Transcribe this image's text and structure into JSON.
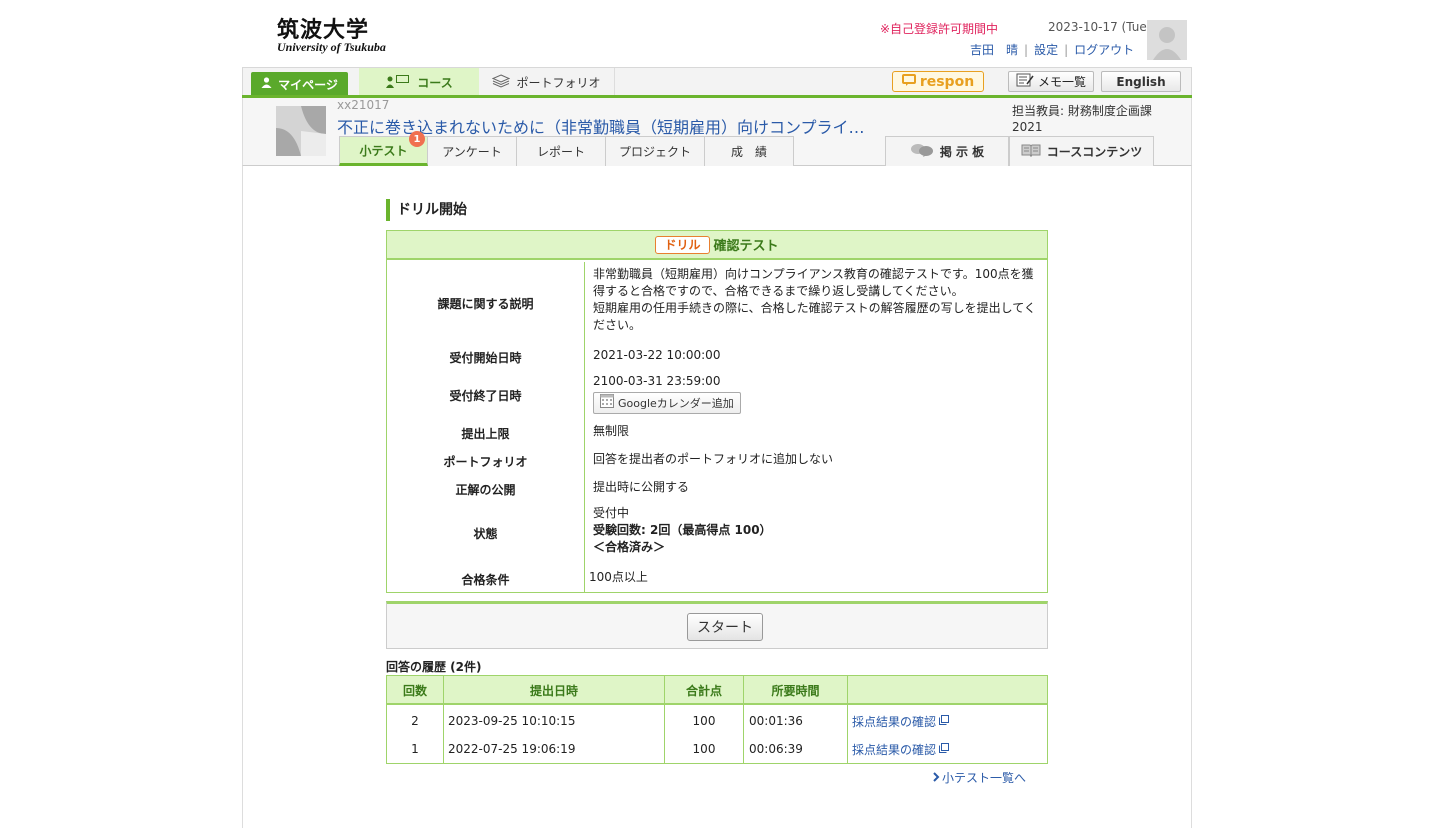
{
  "header": {
    "logo_jp": "筑波大学",
    "logo_en": "University of Tsukuba",
    "registration_notice": "※自己登録許可期間中",
    "date": "2023-10-17 (Tue)",
    "user_name": "吉田　晴",
    "settings_label": "設定",
    "logout_label": "ログアウト"
  },
  "topnav": {
    "mypage_label": "マイページ",
    "course_label": "コース",
    "portfolio_label": "ポートフォリオ",
    "respon_label": "respon",
    "memo_label": "メモ一覧",
    "english_label": "English"
  },
  "course": {
    "code": "xx21017",
    "title": "不正に巻き込まれないために（非常勤職員（短期雇用）向けコンプライ…",
    "teacher": "担当教員: 財務制度企画課",
    "year": "2021",
    "tabs": [
      {
        "label": "小テスト"
      },
      {
        "label": "アンケート"
      },
      {
        "label": "レポート"
      },
      {
        "label": "プロジェクト"
      },
      {
        "label": "成　績"
      }
    ],
    "quiz_badge": "1",
    "board_label": "掲 示 板",
    "contents_label": "コースコンテンツ"
  },
  "section_title": "ドリル開始",
  "drill": {
    "tag": "ドリル",
    "title": "確認テスト",
    "rows": {
      "description_label": "課題に関する説明",
      "description_line1": "非常勤職員（短期雇用）向けコンプライアンス教育の確認テストです。100点を獲得すると合格ですので、合格できるまで繰り返し受講してください。",
      "description_line2": "短期雇用の任用手続きの際に、合格した確認テストの解答履歴の写しを提出してください。",
      "start_label": "受付開始日時",
      "start_value": "2021-03-22 10:00:00",
      "end_label": "受付終了日時",
      "end_value": "2100-03-31 23:59:00",
      "gcal_label": "Googleカレンダー追加",
      "limit_label": "提出上限",
      "limit_value": "無制限",
      "portfolio_label": "ポートフォリオ",
      "portfolio_value": "回答を提出者のポートフォリオに追加しない",
      "answer_label": "正解の公開",
      "answer_value": "提出時に公開する",
      "status_label": "状態",
      "status_value": "受付中",
      "status_count": "受験回数: 2回（最高得点 100）",
      "status_passed": "＜合格済み＞",
      "pass_label": "合格条件",
      "pass_value": "100点以上"
    }
  },
  "start_button": "スタート",
  "history": {
    "title": "回答の履歴 (2件)",
    "headers": [
      "回数",
      "提出日時",
      "合計点",
      "所要時間",
      ""
    ],
    "rows": [
      {
        "count": "2",
        "date": "2023-09-25 10:10:15",
        "score": "100",
        "time": "00:01:36",
        "link": "採点結果の確認"
      },
      {
        "count": "1",
        "date": "2022-07-25 19:06:19",
        "score": "100",
        "time": "00:06:39",
        "link": "採点結果の確認"
      }
    ]
  },
  "back_link": "小テスト一覧へ",
  "colors": {
    "accent_green": "#6ab42d",
    "light_green": "#dff5c7",
    "link_blue": "#2a5aa8",
    "notice_red": "#e0245e",
    "respon_orange": "#e8a020"
  }
}
